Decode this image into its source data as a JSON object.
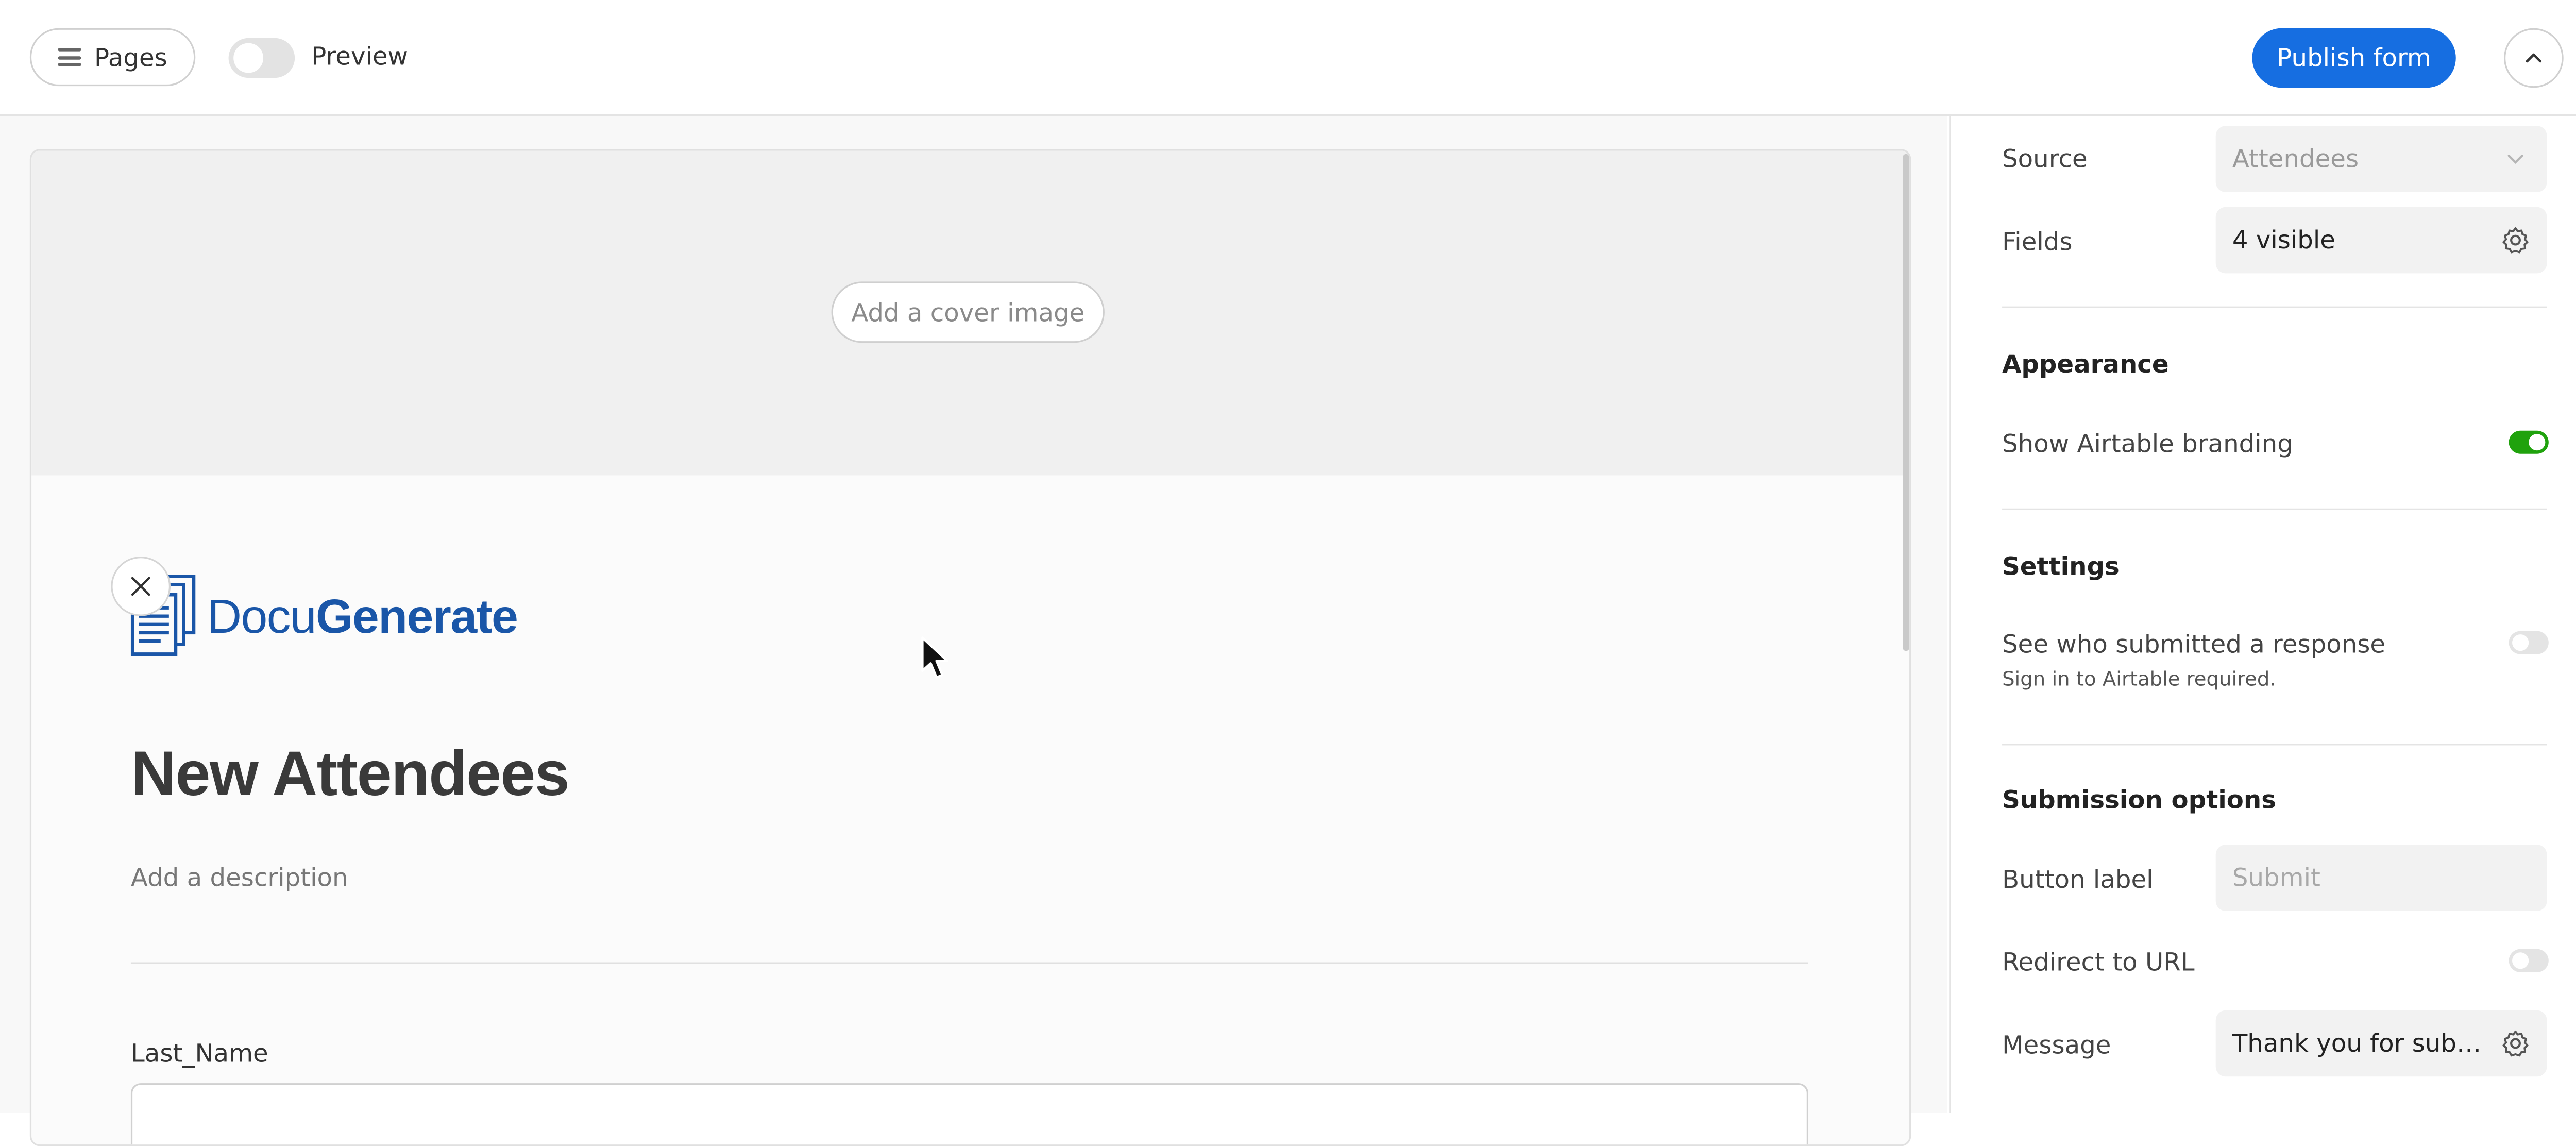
{
  "topbar": {
    "pages_label": "Pages",
    "preview_label": "Preview",
    "publish_label": "Publish form"
  },
  "form": {
    "cover_button": "Add a cover image",
    "logo": {
      "part1": "Docu",
      "part2": "Generate"
    },
    "title": "New Attendees",
    "description_placeholder": "Add a description",
    "fields": [
      {
        "label": "Last_Name",
        "value": ""
      }
    ]
  },
  "sidebar": {
    "source": {
      "label": "Source",
      "value": "Attendees"
    },
    "fields": {
      "label": "Fields",
      "value": "4 visible"
    },
    "appearance": {
      "heading": "Appearance",
      "branding_label": "Show Airtable branding",
      "branding_on": true
    },
    "settings": {
      "heading": "Settings",
      "who_submitted_label": "See who submitted a response",
      "who_submitted_sub": "Sign in to Airtable required.",
      "who_submitted_on": false
    },
    "submission": {
      "heading": "Submission options",
      "button_label_label": "Button label",
      "button_label_placeholder": "Submit",
      "redirect_label": "Redirect to URL",
      "redirect_on": false,
      "message_label": "Message",
      "message_value": "Thank you for sub…"
    }
  },
  "colors": {
    "accent": "#166ee1",
    "toggle_on": "#20a20d",
    "logo_blue": "#1a56a8"
  },
  "icons": [
    "hamburger-icon",
    "chevron-up-icon",
    "close-icon",
    "chevron-down-icon",
    "gear-icon",
    "cursor-icon"
  ]
}
